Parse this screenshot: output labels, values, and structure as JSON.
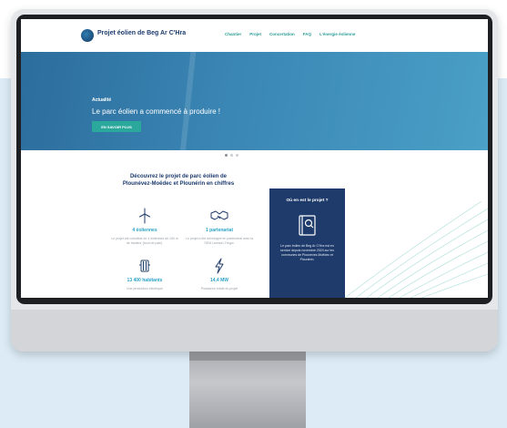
{
  "site": {
    "brand": "Projet éolien de Beg Ar C'Hra",
    "nav": [
      "Chantier",
      "Projet",
      "Concertation",
      "FAQ",
      "L'énergie éolienne"
    ]
  },
  "hero": {
    "tag": "Actualité",
    "title": "Le parc éolien a commencé à produire !",
    "button": "EN SAVOIR PLUS"
  },
  "intro": {
    "title": "Découvrez le projet de parc éolien de Plounévez-Moëdec et Plounérin en chiffres"
  },
  "stats": [
    {
      "icon": "wind-turbine-icon",
      "value": "4 éoliennes",
      "desc": "Le projet est constitué de 4 éoliennes de 150 m de hauteur (bout de pale)."
    },
    {
      "icon": "handshake-icon",
      "value": "1 partenariat",
      "desc": "Le projet a été développé en partenariat avec la SEM Lannion-Trégor."
    },
    {
      "icon": "radiator-icon",
      "value": "13 400 habitants",
      "desc": "Une production électrique"
    },
    {
      "icon": "lightning-icon",
      "value": "14,4 MW",
      "desc": "Puissance totale du projet"
    }
  ],
  "card": {
    "title": "Où en est le projet ?",
    "icon": "book-icon",
    "text": "Le parc éolien de Beg Ar C'Hra est en service depuis novembre 2024 sur les communes de Plounévez-Moëdec et Plounérin."
  },
  "colors": {
    "navy": "#1f3b6b",
    "teal": "#2aa89c",
    "hero_blue": "#3a86b5",
    "stat_value": "#2aa3c6"
  }
}
